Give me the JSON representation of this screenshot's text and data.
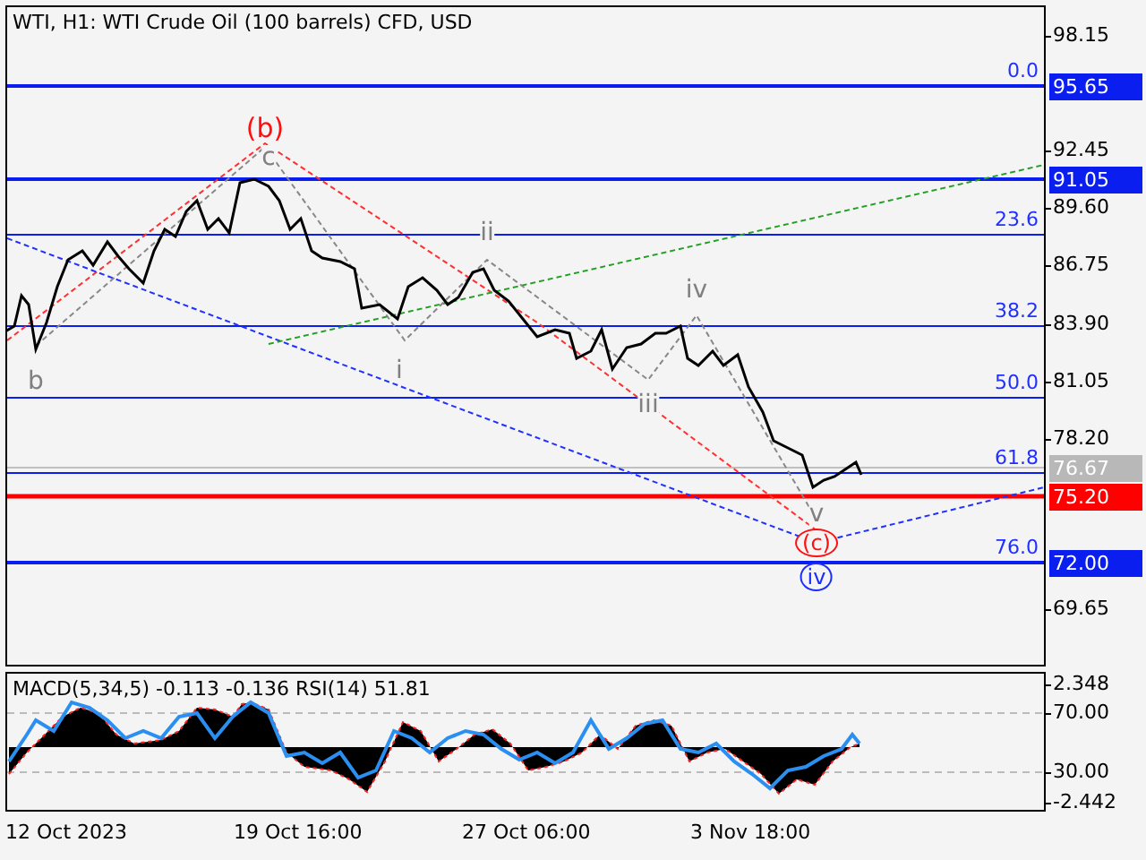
{
  "chart": {
    "title": "WTI, H1:  WTI Crude Oil (100 barrels) CFD, USD",
    "price_axis": [
      "98.15",
      "92.45",
      "89.60",
      "86.75",
      "83.90",
      "81.05",
      "78.20",
      "69.65"
    ],
    "levels": [
      {
        "kind": "major",
        "label": "0.0",
        "tag": "95.65"
      },
      {
        "kind": "major",
        "tag": "91.05"
      },
      {
        "kind": "fib",
        "label": "23.6"
      },
      {
        "kind": "fib",
        "label": "38.2"
      },
      {
        "kind": "fib",
        "label": "50.0"
      },
      {
        "kind": "fib",
        "label": "61.8"
      },
      {
        "kind": "current",
        "tag": "76.67"
      },
      {
        "kind": "target",
        "tag": "75.20"
      },
      {
        "kind": "major",
        "label": "76.0",
        "tag": "72.00"
      }
    ],
    "wave_labels": [
      {
        "text": "(b)",
        "kind": "major"
      },
      {
        "text": "c",
        "kind": "minor"
      },
      {
        "text": "b",
        "kind": "minor"
      },
      {
        "text": "i",
        "kind": "minor"
      },
      {
        "text": "ii",
        "kind": "minor"
      },
      {
        "text": "iii",
        "kind": "minor"
      },
      {
        "text": "iv",
        "kind": "minor"
      },
      {
        "text": "v",
        "kind": "minor"
      },
      {
        "text": "(c)",
        "kind": "circled_red"
      },
      {
        "text": "iv",
        "kind": "circled_blue"
      }
    ]
  },
  "indicator": {
    "title": "MACD(5,34,5) -0.113 -0.136 RSI(14) 51.81",
    "axis": [
      "2.348",
      "70.00",
      "30.00",
      "-2.442"
    ]
  },
  "time_axis": [
    "12 Oct 2023",
    "19 Oct 16:00",
    "27 Oct 06:00",
    "3 Nov 18:00"
  ]
}
